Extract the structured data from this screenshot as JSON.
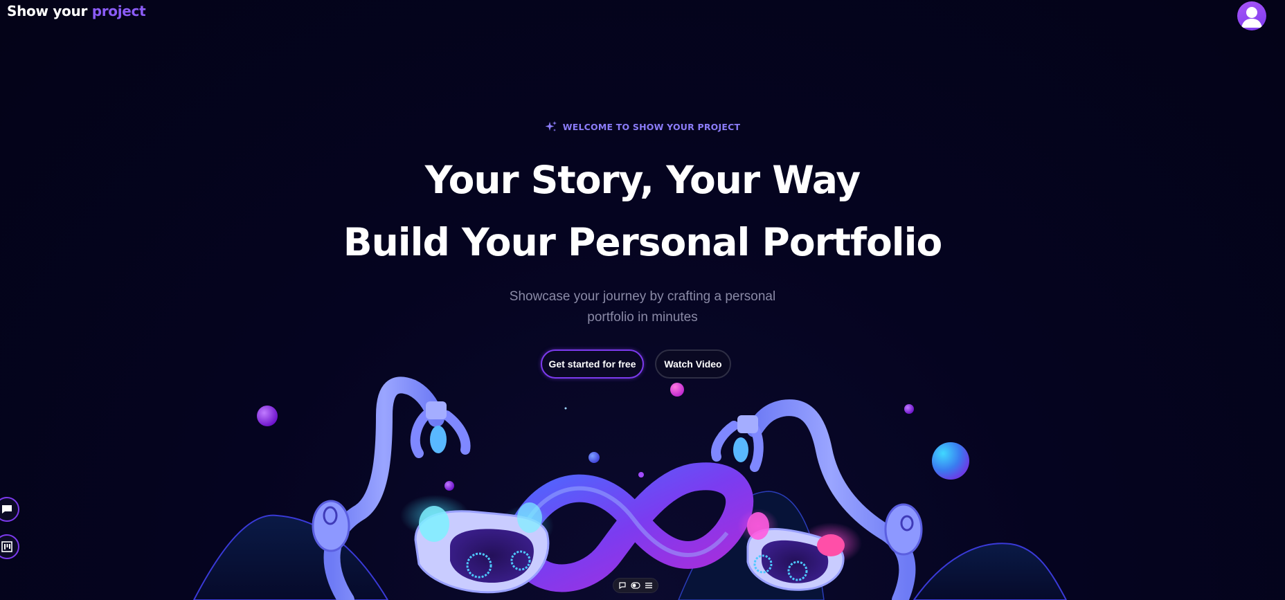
{
  "header": {
    "brand_primary": "Show your",
    "brand_accent": "project",
    "avatar_icon": "user-icon"
  },
  "hero": {
    "eyebrow": "WELCOME TO SHOW YOUR PROJECT",
    "eyebrow_icon": "sparkles-icon",
    "headline_line1": "Your Story, Your Way",
    "headline_line2": "Build Your Personal Portfolio",
    "subtext_line1": "Showcase your journey by crafting a personal",
    "subtext_line2": "portfolio in minutes",
    "cta_primary": "Get started for free",
    "cta_secondary": "Watch Video"
  },
  "side_actions": [
    {
      "icon": "chat-icon"
    },
    {
      "icon": "board-icon"
    }
  ],
  "toolbar": {
    "items": [
      {
        "icon": "comment-icon"
      },
      {
        "icon": "toggle-icon"
      },
      {
        "icon": "menu-icon"
      }
    ]
  },
  "colors": {
    "background": "#040318",
    "accent": "#8b5cf6",
    "primary_border": "#7c3aed",
    "eyebrow": "#8b7cf8",
    "subtext": "#8a8aa6"
  }
}
